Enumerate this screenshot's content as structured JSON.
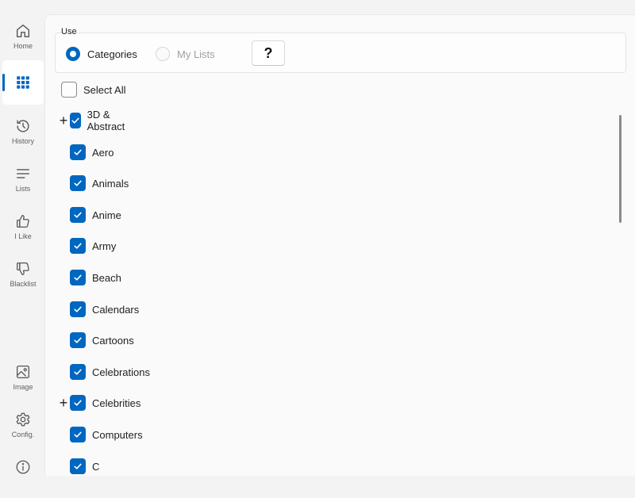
{
  "sidebar": {
    "items": [
      {
        "label": "Home",
        "icon": "home-icon"
      },
      {
        "label": "",
        "icon": "grid-icon",
        "active": true
      },
      {
        "label": "History",
        "icon": "history-icon"
      },
      {
        "label": "Lists",
        "icon": "list-icon"
      },
      {
        "label": "I Like",
        "icon": "thumbs-up-icon"
      },
      {
        "label": "Blacklist",
        "icon": "thumbs-down-icon"
      },
      {
        "label": "Image",
        "icon": "image-icon"
      },
      {
        "label": "Config.",
        "icon": "gear-icon"
      },
      {
        "label": "",
        "icon": "info-icon"
      }
    ]
  },
  "use": {
    "label": "Use",
    "options": [
      {
        "label": "Categories",
        "selected": true
      },
      {
        "label": "My Lists",
        "selected": false,
        "disabled": true
      }
    ],
    "help_label": "?"
  },
  "select_all": {
    "label": "Select All",
    "checked": false
  },
  "categories": [
    {
      "label": "3D & Abstract",
      "checked": true,
      "expandable": true
    },
    {
      "label": "Aero",
      "checked": true,
      "expandable": false
    },
    {
      "label": "Animals",
      "checked": true,
      "expandable": false
    },
    {
      "label": "Anime",
      "checked": true,
      "expandable": false
    },
    {
      "label": "Army",
      "checked": true,
      "expandable": false
    },
    {
      "label": "Beach",
      "checked": true,
      "expandable": false
    },
    {
      "label": "Calendars",
      "checked": true,
      "expandable": false
    },
    {
      "label": "Cartoons",
      "checked": true,
      "expandable": false
    },
    {
      "label": "Celebrations",
      "checked": true,
      "expandable": false
    },
    {
      "label": "Celebrities",
      "checked": true,
      "expandable": true
    },
    {
      "label": "Computers",
      "checked": true,
      "expandable": false
    },
    {
      "label": "C",
      "checked": true,
      "expandable": false
    }
  ],
  "colors": {
    "accent": "#0067c0"
  }
}
